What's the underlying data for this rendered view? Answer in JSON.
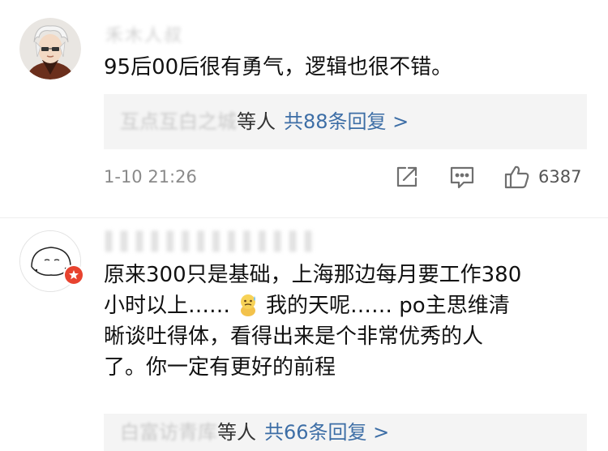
{
  "comments": [
    {
      "username": "禾木人叔",
      "text_lines": [
        "95后00后很有勇气，逻辑也很不错。"
      ],
      "replies": {
        "names": "互点互白之城",
        "suffix": "等人",
        "count_label": "共88条回复 >"
      },
      "timestamp": "1-10 21:26",
      "likes": "6387",
      "icons": [
        "share-icon",
        "comment-icon",
        "thumbs-up-icon"
      ]
    },
    {
      "username": "▌▌▌▌▌▌▌▌▌▌▌▌▌▌",
      "text_lines": [
        {
          "before": "原来300只是基础，上海那边每月要工作380"
        },
        {
          "before": "小时以上……",
          "emoji": "sweat-emoji",
          "after": "我的天呢……  po主思维清"
        },
        {
          "before": "晰谈吐得体，看得出来是个非常优秀的人"
        },
        {
          "before": "了。你一定有更好的前程"
        }
      ],
      "replies": {
        "names": "白富访青库",
        "suffix": "等人",
        "count_label": "共66条回复 >"
      },
      "badge": "weibo-badge-icon"
    }
  ],
  "colors": {
    "link_blue": "#3d6ea6",
    "reply_bg": "#f4f4f4",
    "meta_gray": "#8a8a8a",
    "badge_red": "#e8432f"
  }
}
